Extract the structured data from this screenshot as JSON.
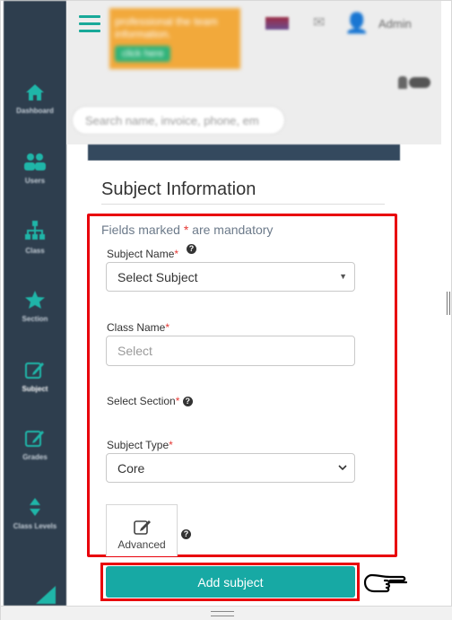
{
  "sidebar": {
    "items": [
      {
        "label": "Dashboard",
        "icon": "home-icon"
      },
      {
        "label": "Users",
        "icon": "users-icon"
      },
      {
        "label": "Class",
        "icon": "sitemap-icon"
      },
      {
        "label": "Section",
        "icon": "star-icon"
      },
      {
        "label": "Subject",
        "icon": "edit-icon"
      },
      {
        "label": "Grades",
        "icon": "edit-icon"
      },
      {
        "label": "Class Levels",
        "icon": "sort-icon"
      }
    ]
  },
  "header": {
    "notice_text": "professional the team information.",
    "notice_button": "click here",
    "user_name": "Admin",
    "search_placeholder": "Search name, invoice, phone, em"
  },
  "card": {
    "title": "Subject Information"
  },
  "form": {
    "mandatory_prefix": "Fields marked ",
    "mandatory_star": "*",
    "mandatory_suffix": " are mandatory",
    "subject_name_label": "Subject Name",
    "subject_name_value": "Select Subject",
    "class_name_label": "Class Name",
    "class_name_placeholder": "Select",
    "section_label": "Select Section",
    "subject_type_label": "Subject Type",
    "subject_type_value": "Core",
    "required_mark": "*",
    "help_mark": "?",
    "advanced_label": "Advanced",
    "submit_label": "Add subject"
  },
  "colors": {
    "accent": "#17a9a4",
    "highlight": "#e8000b",
    "sidebar": "#2e3e4e"
  }
}
